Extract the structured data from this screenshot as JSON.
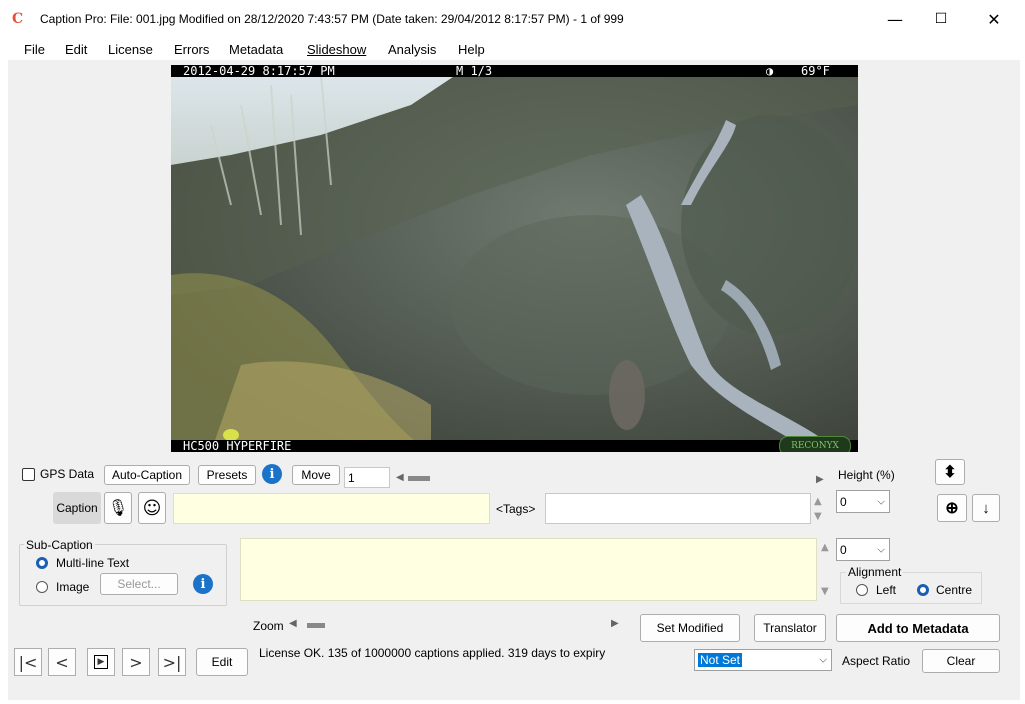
{
  "window": {
    "title": "Caption Pro: File: 001.jpg Modified on 28/12/2020 7:43:57 PM (Date taken: 29/04/2012 8:17:57 PM) - 1 of 999",
    "app_icon_glyph": "C",
    "minimize": "—",
    "maximize": "☐",
    "close": "✕"
  },
  "menu": [
    "File",
    "Edit",
    "License",
    "Errors",
    "Metadata",
    "Slideshow",
    "Analysis",
    "Help"
  ],
  "photo": {
    "osd_top_datetime": "2012-04-29  8:17:57 PM",
    "osd_top_frame": "M 1/3",
    "osd_top_moon": "◑",
    "osd_top_temp": "69°F",
    "osd_bottom_model": "HC500 HYPERFIRE",
    "osd_bottom_logo": "RECONYX"
  },
  "toolbar": {
    "gps_label": "GPS Data",
    "auto_caption": "Auto-Caption",
    "presets": "Presets",
    "info_glyph": "i",
    "move": "Move",
    "move_value": "1",
    "height_label": "Height (%)",
    "height_value": "0",
    "height2_value": "0"
  },
  "caption": {
    "label": "Caption",
    "mic_icon": "mic-icon",
    "emoji_icon": "smiley-icon",
    "value": "",
    "tags_label": "<Tags>",
    "tags_value": ""
  },
  "subcaption": {
    "group_label": "Sub-Caption",
    "multiline_label": "Multi-line Text",
    "image_label": "Image",
    "select_button": "Select...",
    "text_value": ""
  },
  "alignment": {
    "label": "Alignment",
    "left": "Left",
    "centre": "Centre"
  },
  "zoom": {
    "label": "Zoom"
  },
  "actions": {
    "set_modified": "Set Modified",
    "translator": "Translator",
    "add_to_metadata": "Add to Metadata",
    "edit": "Edit",
    "clear": "Clear",
    "aspect_ratio_label": "Aspect Ratio",
    "aspect_ratio_value": "Not Set"
  },
  "status": {
    "license_text": "License OK. 135 of 1000000 captions applied. 319 days to expiry"
  },
  "colors": {
    "yellow_input": "#ffffe1",
    "accent_blue": "#1a73c8",
    "selected_highlight": "#0078d7"
  }
}
